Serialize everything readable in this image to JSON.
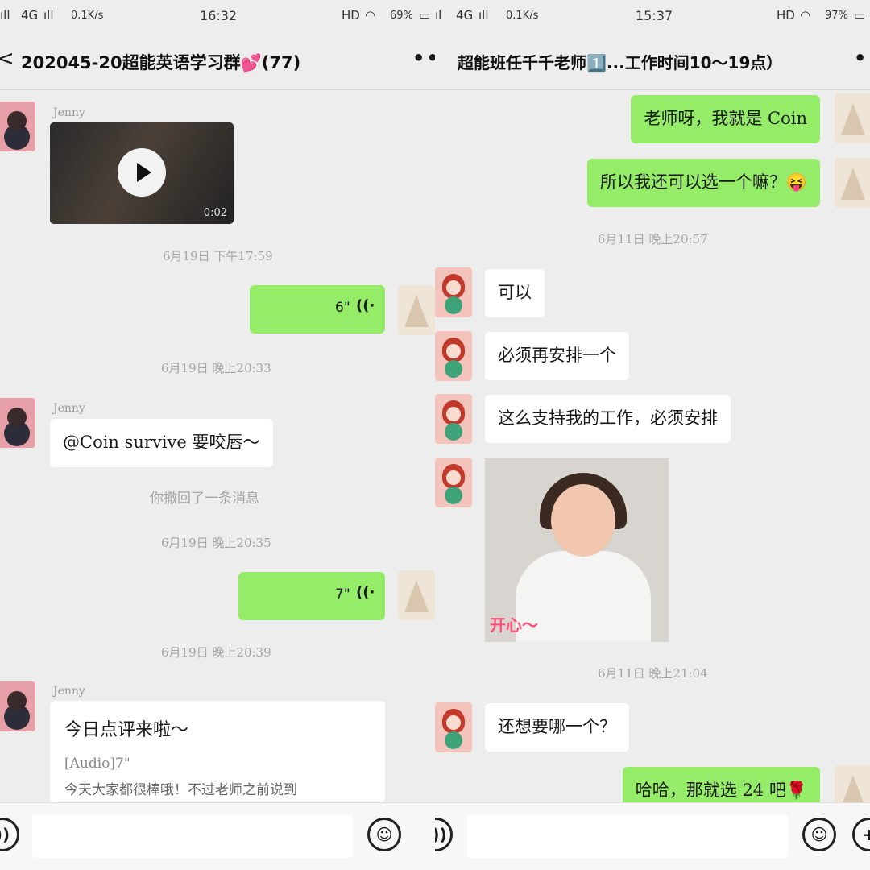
{
  "left": {
    "status": {
      "signal": "4G",
      "speed": "0.1K/s",
      "time": "16:32",
      "hd": "HD",
      "battery": "69%"
    },
    "header": {
      "back": "<",
      "title": "202045-20超能英语学习群💕(77)",
      "more": "•••"
    },
    "messages": {
      "video_sender": "Jenny",
      "video_duration": "0:02",
      "time1": "6月19日 下午17:59",
      "voice1_duration": "6\"",
      "time2": "6月19日 晚上20:33",
      "text_sender": "Jenny",
      "text1": "@Coin survive 要咬唇～",
      "recall_notice": "你撤回了一条消息",
      "time3": "6月19日 晚上20:35",
      "voice2_duration": "7\"",
      "time4": "6月19日 晚上20:39",
      "card_sender": "Jenny",
      "card_title": "今日点评来啦～",
      "card_audio": "[Audio]7\"",
      "card_body": "今天大家都很棒哦！不过老师之前说到"
    },
    "voice_icon": "((·"
  },
  "right": {
    "status": {
      "signal": "4G",
      "speed": "0.1K/s",
      "time": "15:37",
      "hd": "HD",
      "battery": "97%"
    },
    "header": {
      "title": "超能班任千千老师1️⃣...工作时间10～19点）",
      "more": "•••"
    },
    "messages": {
      "m1": "老师呀，我就是 Coin",
      "m2": "所以我还可以选一个嘛？😝",
      "time1": "6月11日 晚上20:57",
      "m3": "可以",
      "m4": "必须再安排一个",
      "m5": "这么支持我的工作，必须安排",
      "sticker_label": "开心～",
      "time2": "6月11日 晚上21:04",
      "m6": "还想要哪一个？",
      "m7": "哈哈，那就选 24 吧🌹"
    }
  },
  "icons": {
    "voice_toggle": "voice-mode-icon",
    "emoji": "emoji-icon",
    "plus": "plus-icon"
  },
  "colors": {
    "bubble_green": "#95ec69",
    "bubble_white": "#ffffff",
    "background": "#ededed"
  }
}
